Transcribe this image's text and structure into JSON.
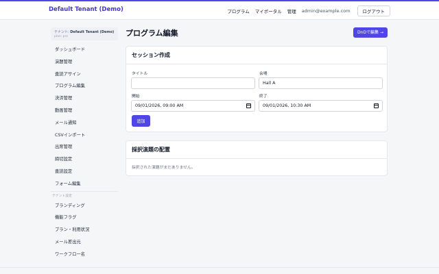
{
  "header": {
    "brand": "Default Tenant (Demo)",
    "nav": [
      "プログラム",
      "マイポータル",
      "管理"
    ],
    "user_email": "admin@example.com",
    "logout_label": "ログアウト"
  },
  "sidebar": {
    "tenant_prefix": "テナント:",
    "tenant_name": "Default Tenant (Demo)",
    "tenant_plan": "plan: pro",
    "items": [
      {
        "label": "ダッシュボード"
      },
      {
        "label": "演題管理"
      },
      {
        "label": "査読アサイン"
      },
      {
        "label": "プログラム編集"
      },
      {
        "label": "決済管理"
      },
      {
        "label": "動画管理"
      },
      {
        "label": "メール通知"
      },
      {
        "label": "CSVインポート"
      },
      {
        "label": "出席管理"
      },
      {
        "label": "締切設定"
      },
      {
        "label": "査読設定"
      },
      {
        "label": "フォーム編集"
      }
    ],
    "tenant_section_title": "テナント設定",
    "tenant_items": [
      {
        "label": "ブランディング"
      },
      {
        "label": "機能フラグ"
      },
      {
        "label": "プラン・利用状況"
      },
      {
        "label": "メール差出元"
      },
      {
        "label": "ワークフロー名"
      }
    ]
  },
  "main": {
    "title": "プログラム編集",
    "dnd_button": "DnDで編集 →",
    "session_card": {
      "title": "セッション作成",
      "title_label": "タイトル",
      "title_value": "",
      "venue_label": "会場",
      "venue_value": "Hall A",
      "start_label": "開始",
      "start_value": "09/01/2026, 09:00 AM",
      "end_label": "終了",
      "end_value": "09/01/2026, 10:30 AM",
      "add_button": "追加"
    },
    "placement_card": {
      "title": "採択演題の配置",
      "empty_text": "採択された演題がまだありません。"
    }
  },
  "colors": {
    "accent": "#4f46e5",
    "brand_text": "#4338ca",
    "background": "#f5f6f8"
  }
}
